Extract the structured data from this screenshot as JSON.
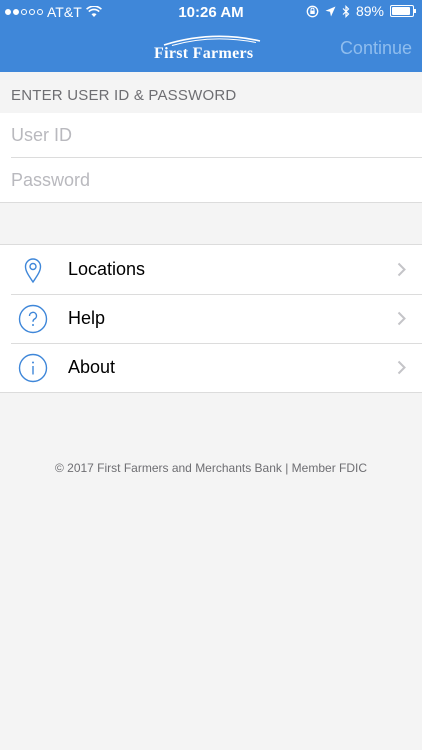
{
  "status_bar": {
    "carrier": "AT&T",
    "time": "10:26 AM",
    "battery": "89%"
  },
  "header": {
    "logo_text": "First Farmers",
    "continue_label": "Continue"
  },
  "login": {
    "section_title": "ENTER USER ID & PASSWORD",
    "user_id_placeholder": "User ID",
    "password_placeholder": "Password"
  },
  "menu": {
    "items": [
      {
        "label": "Locations",
        "icon": "location-pin-icon"
      },
      {
        "label": "Help",
        "icon": "question-circle-icon"
      },
      {
        "label": "About",
        "icon": "info-circle-icon"
      }
    ]
  },
  "footer": {
    "text": "© 2017 First Farmers and Merchants Bank | Member FDIC"
  },
  "colors": {
    "header_bg": "#3f87d9",
    "icon_blue": "#3f87d9",
    "background": "#f4f4f4"
  }
}
